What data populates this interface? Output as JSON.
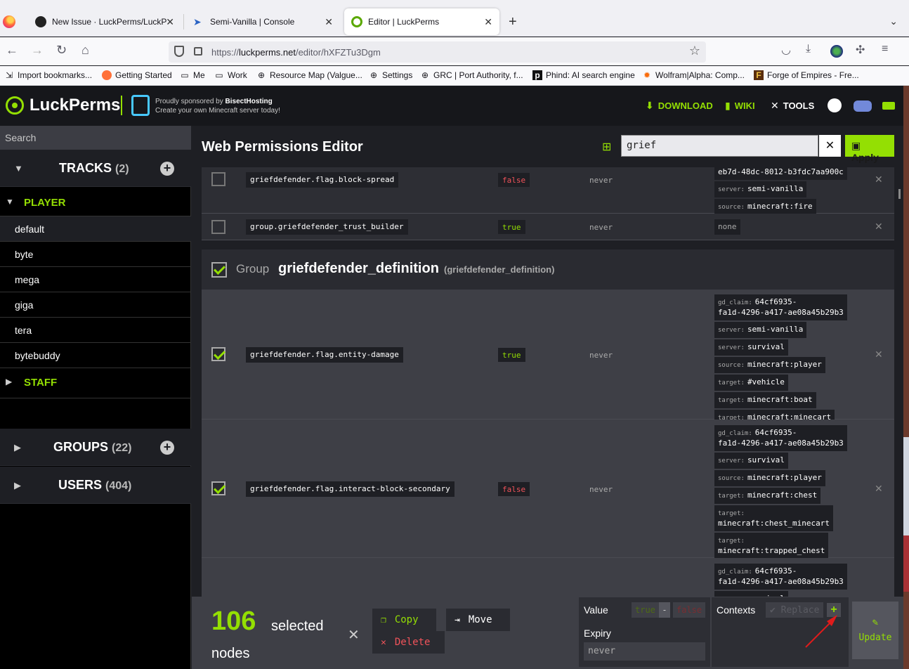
{
  "browser": {
    "tabs": [
      {
        "title": "New Issue · LuckPerms/LuckPer"
      },
      {
        "title": "Semi-Vanilla | Console"
      },
      {
        "title": "Editor | LuckPerms"
      }
    ],
    "url_prefix": "https://",
    "url_host": "luckperms.net",
    "url_path": "/editor/hXFZTu3Dgm",
    "bookmarks": [
      "Import bookmarks...",
      "Getting Started",
      "Me",
      "Work",
      "Resource Map (Valgue...",
      "Settings",
      "GRC | Port Authority, f...",
      "Phind: AI search engine",
      "Wolfram|Alpha: Comp...",
      "Forge of Empires - Fre..."
    ]
  },
  "header": {
    "brand": "LuckPerms",
    "sponsor_line1_prefix": "Proudly sponsored by ",
    "sponsor_name": "BisectHosting",
    "sponsor_line2": "Create your own Minecraft server today!",
    "nav": {
      "download": "DOWNLOAD",
      "wiki": "WIKI",
      "tools": "TOOLS"
    }
  },
  "sidebar": {
    "search_placeholder": "Search",
    "tracks": {
      "label": "TRACKS",
      "count": "(2)"
    },
    "track_player": "PLAYER",
    "player_groups": [
      "default",
      "byte",
      "mega",
      "giga",
      "tera",
      "bytebuddy"
    ],
    "track_staff": "STAFF",
    "groups": {
      "label": "GROUPS",
      "count": "(22)"
    },
    "users": {
      "label": "USERS",
      "count": "(404)"
    }
  },
  "editor": {
    "title": "Web Permissions Editor",
    "filter_value": "grief",
    "apply_label": "Apply",
    "rows_top": [
      {
        "permission": "griefdefender.flag.block-spread",
        "value": "false",
        "expiry": "never",
        "contexts": [
          {
            "key": "",
            "value": "eb7d-48dc-8012-b3fdc7aa900c"
          },
          {
            "key": "server:",
            "value": "semi-vanilla"
          },
          {
            "key": "source:",
            "value": "minecraft:fire"
          }
        ]
      },
      {
        "permission": "group.griefdefender_trust_builder",
        "value": "true",
        "expiry": "never",
        "contexts_none": "none"
      }
    ],
    "group": {
      "label": "Group",
      "name": "griefdefender_definition",
      "display": "(griefdefender_definition)"
    },
    "rows_group": [
      {
        "permission": "griefdefender.flag.entity-damage",
        "value": "true",
        "expiry": "never",
        "contexts": [
          {
            "key": "gd_claim:",
            "value": "64cf6935-",
            "value2": "fa1d-4296-a417-ae08a45b29b3"
          },
          {
            "key": "server:",
            "value": "semi-vanilla"
          },
          {
            "key": "server:",
            "value": "survival"
          },
          {
            "key": "source:",
            "value": "minecraft:player"
          },
          {
            "key": "target:",
            "value": "#vehicle"
          },
          {
            "key": "target:",
            "value": "minecraft:boat"
          },
          {
            "key": "target:",
            "value": "minecraft:minecart"
          }
        ]
      },
      {
        "permission": "griefdefender.flag.interact-block-secondary",
        "value": "false",
        "expiry": "never",
        "contexts": [
          {
            "key": "gd_claim:",
            "value": "64cf6935-",
            "value2": "fa1d-4296-a417-ae08a45b29b3"
          },
          {
            "key": "server:",
            "value": "survival"
          },
          {
            "key": "source:",
            "value": "minecraft:player"
          },
          {
            "key": "target:",
            "value": "minecraft:chest"
          },
          {
            "key": "target:",
            "value": "",
            "value2": "minecraft:chest_minecart"
          },
          {
            "key": "target:",
            "value": "",
            "value2": "minecraft:trapped_chest"
          }
        ]
      },
      {
        "contexts": [
          {
            "key": "gd_claim:",
            "value": "64cf6935-",
            "value2": "fa1d-4296-a417-ae08a45b29b3"
          },
          {
            "key": "server:",
            "value": "survival"
          }
        ]
      }
    ]
  },
  "bottom": {
    "selected_count": "106",
    "selected_word": "selected",
    "nodes_word": "nodes",
    "copy": "Copy",
    "move": "Move",
    "delete": "Delete",
    "value_label": "Value",
    "true": "true",
    "dash": "-",
    "false": "false",
    "expiry_label": "Expiry",
    "expiry_value": "never",
    "contexts_label": "Contexts",
    "replace": "Replace",
    "plus": "+",
    "update": "Update"
  },
  "colors": {
    "accent": "#94df03",
    "false": "#f1535a",
    "bg": "#1e1f24"
  }
}
